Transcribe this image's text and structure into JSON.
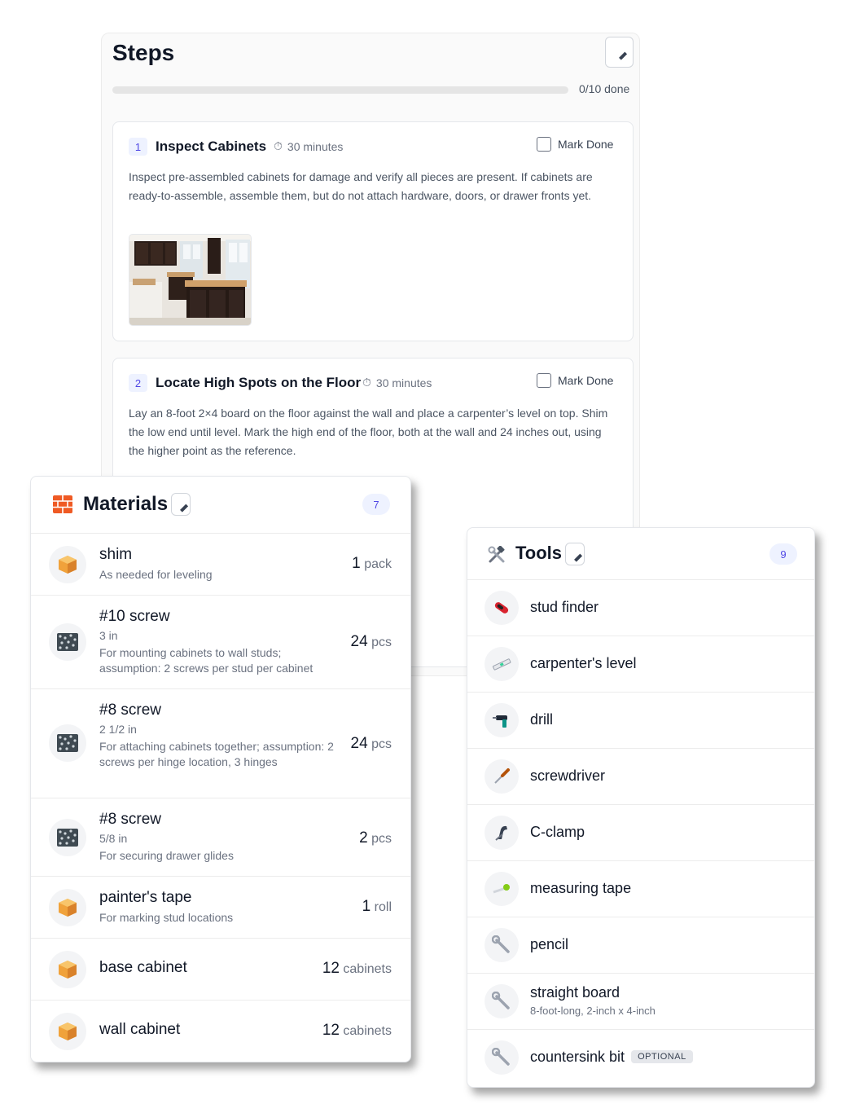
{
  "steps": {
    "title": "Steps",
    "progress_text": "0/10 done",
    "progress_fraction": 0,
    "items": [
      {
        "number": "1",
        "title": "Inspect Cabinets",
        "time": "30 minutes",
        "mark_done": "Mark Done",
        "description": "Inspect pre-assembled cabinets for damage and verify all pieces are present. If cabinets are ready-to-assemble, assemble them, but do not attach hardware, doors, or drawer fronts yet."
      },
      {
        "number": "2",
        "title": "Locate High Spots on the Floor",
        "time": "30 minutes",
        "mark_done": "Mark Done",
        "description": "Lay an 8-foot 2×4 board on the floor against the wall and place a carpenter’s level on top. Shim the low end until level. Mark the high end of the floor, both at the wall and 24 inches out, using the higher point as the reference."
      }
    ]
  },
  "materials": {
    "title": "Materials",
    "count": "7",
    "items": [
      {
        "name": "shim",
        "sub": [
          "As needed for leveling"
        ],
        "qty": "1",
        "unit": "pack",
        "icon": "box-icon"
      },
      {
        "name": "#10 screw",
        "sub": [
          "3 in",
          "For mounting cabinets to wall studs; assumption: 2 screws per stud per cabinet"
        ],
        "qty": "24",
        "unit": "pcs",
        "icon": "screws-icon"
      },
      {
        "name": "#8 screw",
        "sub": [
          "2 1/2 in",
          "For attaching cabinets together; assumption: 2 screws per hinge location, 3 hinges"
        ],
        "qty": "24",
        "unit": "pcs",
        "icon": "screws-icon"
      },
      {
        "name": "#8 screw",
        "sub": [
          "5/8 in",
          "For securing drawer glides"
        ],
        "qty": "2",
        "unit": "pcs",
        "icon": "screws-icon"
      },
      {
        "name": "painter's tape",
        "sub": [
          "For marking stud locations"
        ],
        "qty": "1",
        "unit": "roll",
        "icon": "box-icon"
      },
      {
        "name": "base cabinet",
        "sub": [],
        "qty": "12",
        "unit": "cabinets",
        "icon": "box-icon"
      },
      {
        "name": "wall cabinet",
        "sub": [],
        "qty": "12",
        "unit": "cabinets",
        "icon": "box-icon"
      }
    ]
  },
  "tools": {
    "title": "Tools",
    "count": "9",
    "items": [
      {
        "name": "stud finder",
        "sub": "",
        "optional": "",
        "icon": "stud-finder-icon"
      },
      {
        "name": "carpenter's level",
        "sub": "",
        "optional": "",
        "icon": "level-icon"
      },
      {
        "name": "drill",
        "sub": "",
        "optional": "",
        "icon": "drill-icon"
      },
      {
        "name": "screwdriver",
        "sub": "",
        "optional": "",
        "icon": "screwdriver-icon"
      },
      {
        "name": "C-clamp",
        "sub": "",
        "optional": "",
        "icon": "clamp-icon"
      },
      {
        "name": "measuring tape",
        "sub": "",
        "optional": "",
        "icon": "measuring-tape-icon"
      },
      {
        "name": "pencil",
        "sub": "",
        "optional": "",
        "icon": "wrench-icon"
      },
      {
        "name": "straight board",
        "sub": "8-foot-long, 2-inch x 4-inch",
        "optional": "",
        "icon": "wrench-icon"
      },
      {
        "name": "countersink bit",
        "sub": "",
        "optional": "OPTIONAL",
        "icon": "wrench-icon"
      }
    ]
  },
  "colors": {
    "accent": "#4f46e5",
    "badge_bg": "#eef2ff",
    "materials_icon": "#ef5a24",
    "box": "#f0a23b"
  }
}
